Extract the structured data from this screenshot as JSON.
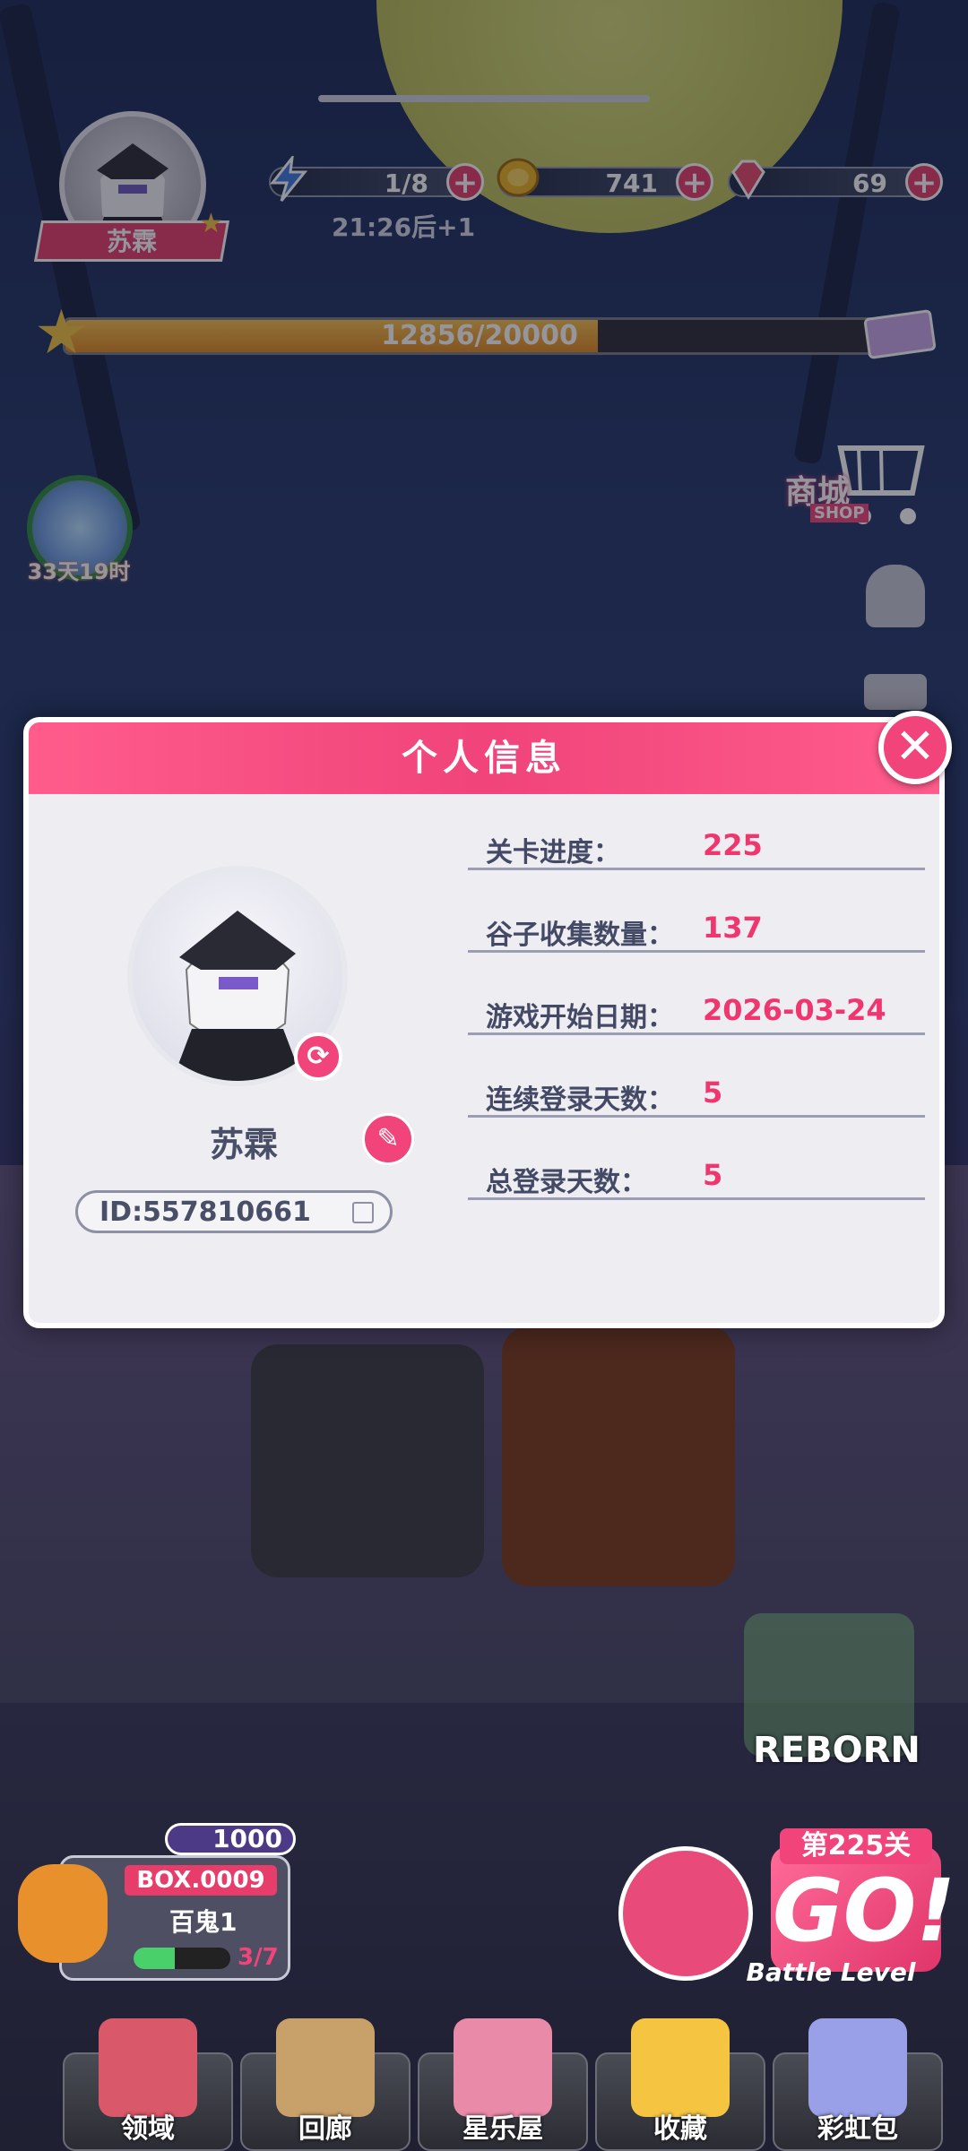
{
  "hud": {
    "player_name": "苏霖",
    "energy": "1/8",
    "energy_timer": "21:26后+1",
    "coins": "741",
    "gems": "69",
    "exp": "12856/20000",
    "exp_fraction": 0.643,
    "event_timer": "33天19时",
    "shop_label": "商城",
    "shop_sub": "SHOP"
  },
  "modal": {
    "title": "个人信息",
    "name": "苏霖",
    "id": "ID:557810661",
    "rows": [
      {
        "label": "关卡进度：",
        "value": "225"
      },
      {
        "label": "谷子收集数量：",
        "value": "137"
      },
      {
        "label": "游戏开始日期：",
        "value": "2026-03-24"
      },
      {
        "label": "连续登录天数：",
        "value": "5"
      },
      {
        "label": "总登录天数：",
        "value": "5"
      }
    ]
  },
  "box": {
    "currency": "1000",
    "box_label": "BOX.0009",
    "name": "百鬼1",
    "progress": "3/7",
    "progress_fraction": 0.43
  },
  "go": {
    "stage": "第225关",
    "go": "GO!",
    "sub": "Battle Level"
  },
  "reborn": "REBORN",
  "nav": [
    {
      "label": "领域"
    },
    {
      "label": "回廊"
    },
    {
      "label": "星乐屋"
    },
    {
      "label": "收藏"
    },
    {
      "label": "彩虹包"
    }
  ],
  "colors": {
    "accent": "#f0447a",
    "value": "#f0366f",
    "label": "#444a66"
  }
}
